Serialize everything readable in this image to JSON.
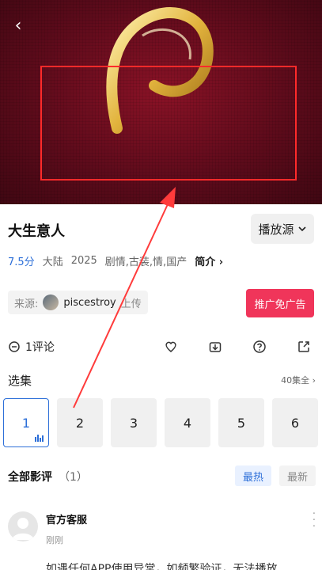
{
  "header": {
    "back_icon": "back-chevron-icon"
  },
  "title": "大生意人",
  "source_button": "播放源",
  "meta": {
    "score": "7.5分",
    "region": "大陆",
    "year": "2025",
    "genres": "剧情,古装,情,国产",
    "intro": "简介"
  },
  "uploader": {
    "label": "来源:",
    "name": "piscestroy",
    "suffix": "上传"
  },
  "ad_button": "推广免广告",
  "actions": {
    "comments": "1评论"
  },
  "episodes": {
    "label": "选集",
    "all": "40集全",
    "items": [
      "1",
      "2",
      "3",
      "4",
      "5",
      "6"
    ]
  },
  "reviews": {
    "title": "全部影评",
    "count": "（1）",
    "tab_hot": "最热",
    "tab_new": "最新"
  },
  "comment": {
    "user": "官方客服",
    "time": "刚刚",
    "text": "如遇任何APP使用异常，如频繁验证，无法播放"
  },
  "colors": {
    "accent": "#2d6fd8",
    "ad": "#f0355a",
    "annotation": "#ff2a2a"
  }
}
